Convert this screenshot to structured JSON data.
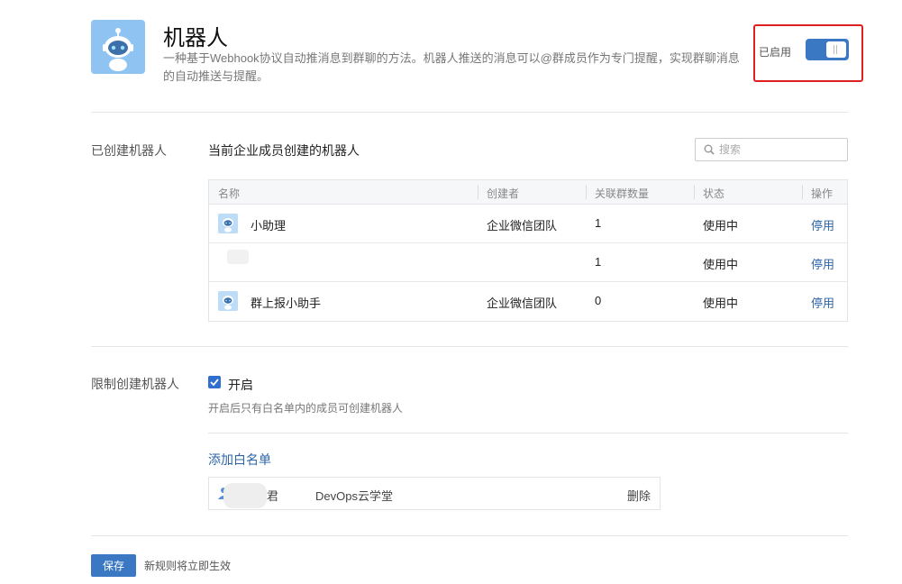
{
  "header": {
    "title": "机器人",
    "description": "一种基于Webhook协议自动推消息到群聊的方法。机器人推送的消息可以@群成员作为专门提醒，实现群聊消息的自动推送与提醒。",
    "toggle_label": "已启用",
    "toggle_on": true
  },
  "created_section": {
    "label": "已创建机器人",
    "title": "当前企业成员创建的机器人",
    "search_placeholder": "搜索",
    "columns": [
      "名称",
      "创建者",
      "关联群数量",
      "状态",
      "操作"
    ],
    "rows": [
      {
        "name": "小助理",
        "creator": "企业微信团队",
        "group_count": "1",
        "status": "使用中",
        "action": "停用"
      },
      {
        "name": "",
        "creator": "",
        "group_count": "1",
        "status": "使用中",
        "action": "停用"
      },
      {
        "name": "群上报小助手",
        "creator": "企业微信团队",
        "group_count": "0",
        "status": "使用中",
        "action": "停用"
      }
    ]
  },
  "restrict_section": {
    "label": "限制创建机器人",
    "checkbox_label": "开启",
    "checked": true,
    "hint": "开启后只有白名单内的成员可创建机器人",
    "whitelist_title": "添加白名单",
    "whitelist": [
      {
        "partial_name": "君",
        "org": "DevOps云学堂",
        "action": "删除"
      }
    ]
  },
  "footer": {
    "save_label": "保存",
    "save_hint": "新规则将立即生效"
  },
  "colors": {
    "accent": "#3a78c3",
    "link": "#2d65a9",
    "highlight_border": "#e02020"
  }
}
